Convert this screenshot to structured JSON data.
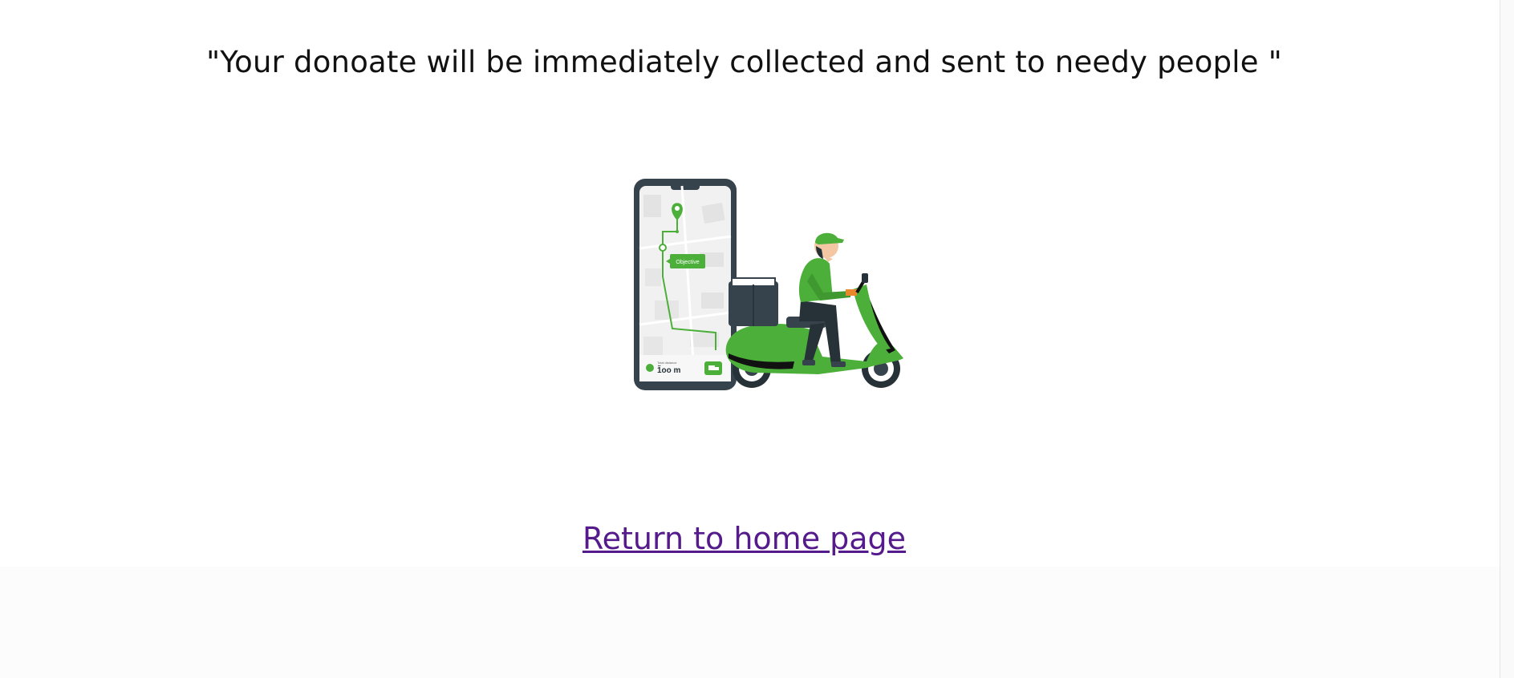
{
  "quote": {
    "text": "\"Your donoate will be immediately collected and sent to needy people \""
  },
  "illustration": {
    "objective_label": "Objective",
    "distance_caption": "Total distance",
    "distance_value": "1̃oo m",
    "accent_color": "#4caf3a",
    "dark_color": "#37434c"
  },
  "link": {
    "label": "Return to home page",
    "color": "#551a8b"
  }
}
